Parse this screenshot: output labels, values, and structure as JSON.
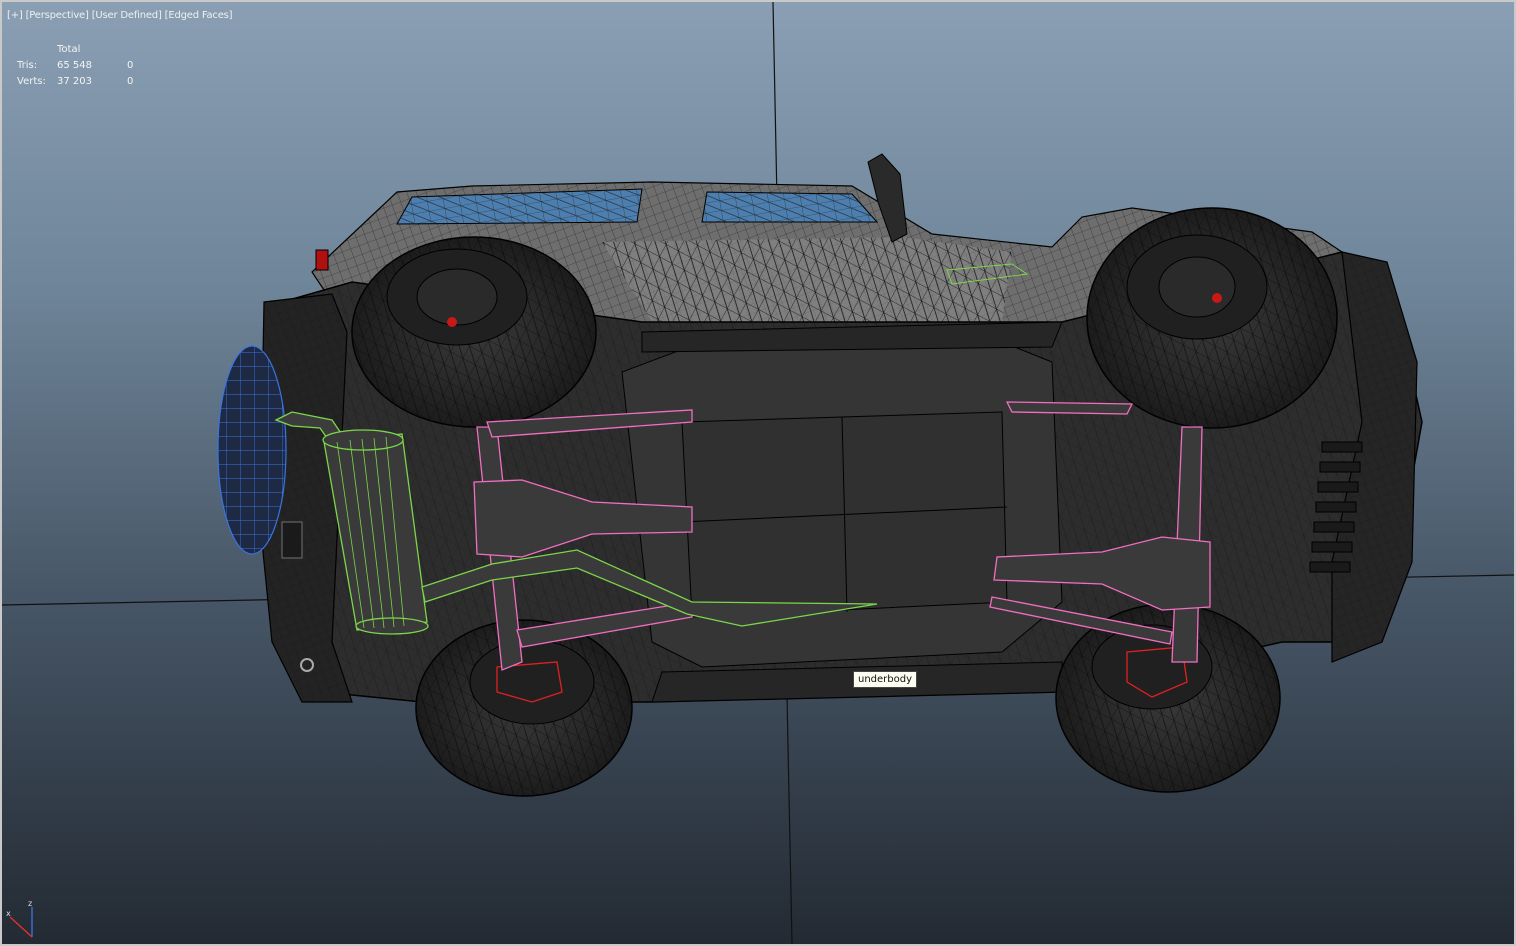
{
  "viewport": {
    "label_parts": [
      "[+]",
      "[Perspective]",
      "[User Defined]",
      "[Edged Faces]"
    ],
    "background_top": "#8a9fb4",
    "background_bottom": "#232a33"
  },
  "stats": {
    "header": "Total",
    "rows": [
      {
        "label": "Tris:",
        "total": "65 548",
        "selected": "0"
      },
      {
        "label": "Verts:",
        "total": "37 203",
        "selected": "0"
      }
    ]
  },
  "tooltip": {
    "text": "underbody"
  },
  "gizmo": {
    "axes": [
      "z",
      "x"
    ],
    "x_color": "#e03030",
    "z_color": "#3a6ad8"
  },
  "wire_colors": {
    "body": "#000000",
    "exhaust": "#7cd64a",
    "axles": "#f06fc0",
    "spare_tire": "#3a74e0",
    "brakes": "#e02020"
  }
}
